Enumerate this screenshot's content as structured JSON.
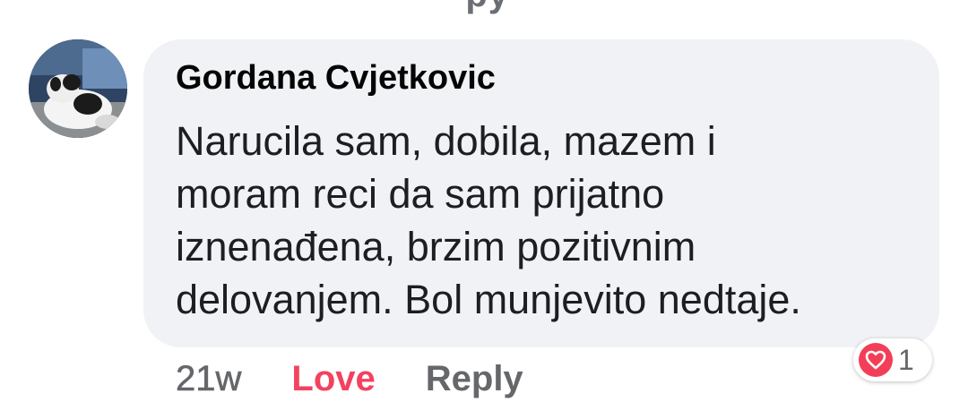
{
  "comment": {
    "author": "Gordana Cvjetkovic",
    "body_lines": [
      "Narucila sam, dobila, mazem i",
      "moram reci da sam prijatno",
      "iznenađena, brzim pozitivnim",
      "delovanjem. Bol munjevito nedtaje."
    ],
    "timestamp": "21w",
    "love_label": "Love",
    "reply_label": "Reply",
    "reaction": {
      "icon": "heart-icon",
      "count": "1"
    }
  },
  "colors": {
    "bubble": "#f0f2f5",
    "love": "#f33e58",
    "secondary_text": "#65676b"
  }
}
